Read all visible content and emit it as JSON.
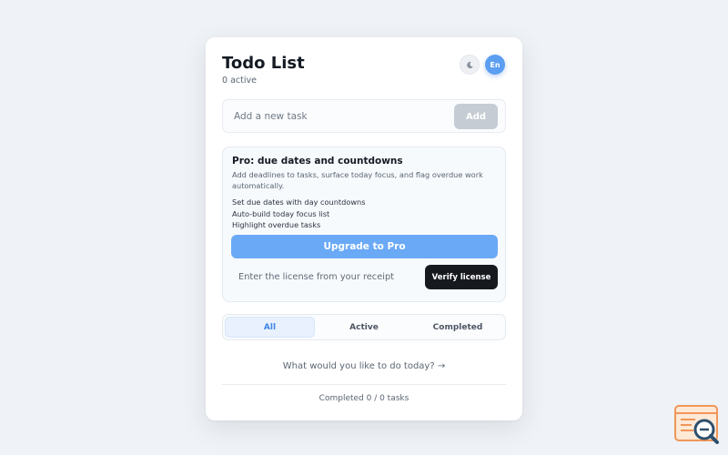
{
  "header": {
    "title": "Todo List",
    "active_count": "0 active",
    "theme_icon": "moon-icon",
    "lang_label": "En"
  },
  "add_task": {
    "placeholder": "Add a new task",
    "value": "",
    "button_label": "Add"
  },
  "pro": {
    "title": "Pro: due dates and countdowns",
    "description": "Add deadlines to tasks, surface today focus, and flag overdue work automatically.",
    "features": [
      "Set due dates with day countdowns",
      "Auto-build today focus list",
      "Highlight overdue tasks"
    ],
    "upgrade_label": "Upgrade to Pro",
    "license_placeholder": "Enter the license from your receipt",
    "license_value": "",
    "verify_label": "Verify license"
  },
  "filters": {
    "tabs": [
      "All",
      "Active",
      "Completed"
    ],
    "selected": "All"
  },
  "empty_state": "What would you like to do today? →",
  "footer": "Completed 0 / 0 tasks",
  "colors": {
    "accent": "#5b9ef2",
    "upgrade": "#6aa9f6",
    "verify": "#161a1f",
    "add_disabled": "#c6ccd4"
  }
}
